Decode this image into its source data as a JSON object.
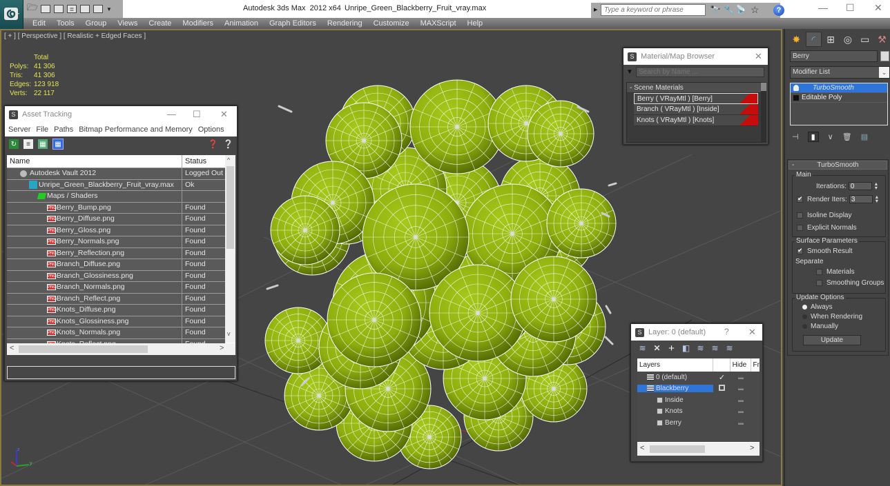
{
  "titlebar": {
    "app_title": "Autodesk 3ds Max  2012 x64",
    "file_name": "Unripe_Green_Blackberry_Fruit_vray.max",
    "search_placeholder": "Type a keyword or phrase",
    "window_controls": {
      "minimize": "—",
      "maximize": "☐",
      "close": "✕"
    }
  },
  "menubar": {
    "items": [
      "Edit",
      "Tools",
      "Group",
      "Views",
      "Create",
      "Modifiers",
      "Animation",
      "Graph Editors",
      "Rendering",
      "Customize",
      "MAXScript",
      "Help"
    ]
  },
  "viewport": {
    "label": "[ + ] [ Perspective ] [ Realistic + Edged Faces ]",
    "stats": {
      "header": "Total",
      "rows": [
        {
          "key": "Polys:",
          "value": "41 306"
        },
        {
          "key": "Tris:",
          "value": "41 306"
        },
        {
          "key": "Edges:",
          "value": "123 918"
        },
        {
          "key": "Verts:",
          "value": "22 117"
        }
      ]
    },
    "model_color": "#8fae0e",
    "wire_color": "#ffffff"
  },
  "asset_tracking": {
    "title": "Asset Tracking",
    "menu": [
      "Server",
      "File",
      "Paths",
      "Bitmap Performance and Memory",
      "Options"
    ],
    "columns": {
      "name": "Name",
      "status": "Status"
    },
    "rows": [
      {
        "name": "Autodesk Vault 2012",
        "status": "Logged Out",
        "type": "vault",
        "indent": 1
      },
      {
        "name": "Unripe_Green_Blackberry_Fruit_vray.max",
        "status": "Ok",
        "type": "max",
        "indent": 2
      },
      {
        "name": "Maps / Shaders",
        "status": "",
        "type": "maps",
        "indent": 3
      },
      {
        "name": "Berry_Bump.png",
        "status": "Found",
        "type": "png",
        "indent": 4
      },
      {
        "name": "Berry_Diffuse.png",
        "status": "Found",
        "type": "png",
        "indent": 4
      },
      {
        "name": "Berry_Gloss.png",
        "status": "Found",
        "type": "png",
        "indent": 4
      },
      {
        "name": "Berry_Normals.png",
        "status": "Found",
        "type": "png",
        "indent": 4
      },
      {
        "name": "Berry_Reflection.png",
        "status": "Found",
        "type": "png",
        "indent": 4
      },
      {
        "name": "Branch_Diffuse.png",
        "status": "Found",
        "type": "png",
        "indent": 4
      },
      {
        "name": "Branch_Glossiness.png",
        "status": "Found",
        "type": "png",
        "indent": 4
      },
      {
        "name": "Branch_Normals.png",
        "status": "Found",
        "type": "png",
        "indent": 4
      },
      {
        "name": "Branch_Reflect.png",
        "status": "Found",
        "type": "png",
        "indent": 4
      },
      {
        "name": "Knots_Diffuse.png",
        "status": "Found",
        "type": "png",
        "indent": 4
      },
      {
        "name": "Knots_Glossiness.png",
        "status": "Found",
        "type": "png",
        "indent": 4
      },
      {
        "name": "Knots_Normals.png",
        "status": "Found",
        "type": "png",
        "indent": 4
      },
      {
        "name": "Knots_Reflect.png",
        "status": "Found",
        "type": "png",
        "indent": 4
      }
    ]
  },
  "material_browser": {
    "title": "Material/Map Browser",
    "search_placeholder": "Search by Name ...",
    "group": "- Scene Materials",
    "materials": [
      {
        "label": "Berry  ( VRayMtl ) [Berry]",
        "selected": true
      },
      {
        "label": "Branch  ( VRayMtl ) [Inside]",
        "selected": false
      },
      {
        "label": "Knots  ( VRayMtl ) [Knots]",
        "selected": false
      }
    ],
    "swatch_color": "#c50d0d"
  },
  "layer_window": {
    "title": "Layer: 0 (default)",
    "help": "?",
    "columns": {
      "layers": "Layers",
      "hide": "Hide",
      "freeze": "Fr"
    },
    "rows": [
      {
        "name": "0 (default)",
        "kind": "layer",
        "current": "✓",
        "selected": false,
        "indent": 1
      },
      {
        "name": "Blackberry",
        "kind": "layer",
        "current": "box",
        "selected": true,
        "indent": 1
      },
      {
        "name": "Inside",
        "kind": "object",
        "current": "",
        "selected": false,
        "indent": 2
      },
      {
        "name": "Knots",
        "kind": "object",
        "current": "",
        "selected": false,
        "indent": 2
      },
      {
        "name": "Berry",
        "kind": "object",
        "current": "",
        "selected": false,
        "indent": 2
      }
    ]
  },
  "command_panel": {
    "object_name": "Berry",
    "modifier_list": "Modifier List",
    "stack": [
      {
        "label": "TurboSmooth",
        "selected": true
      },
      {
        "label": "Editable Poly",
        "selected": false
      }
    ],
    "rollout_title": "TurboSmooth",
    "main_group": "Main",
    "iterations_label": "Iterations:",
    "iterations_value": "0",
    "render_iters_label": "Render Iters:",
    "render_iters_value": "3",
    "render_iters_checked": true,
    "isoline_label": "Isoline Display",
    "isoline_checked": false,
    "explicit_normals_label": "Explicit Normals",
    "explicit_normals_checked": false,
    "surface_group": "Surface Parameters",
    "smooth_result_label": "Smooth Result",
    "smooth_result_checked": true,
    "separate_label": "Separate",
    "materials_label": "Materials",
    "materials_checked": false,
    "smoothing_groups_label": "Smoothing Groups",
    "smoothing_groups_checked": false,
    "update_group": "Update Options",
    "update_options": [
      "Always",
      "When Rendering",
      "Manually"
    ],
    "update_selected": "Always",
    "update_button": "Update"
  }
}
